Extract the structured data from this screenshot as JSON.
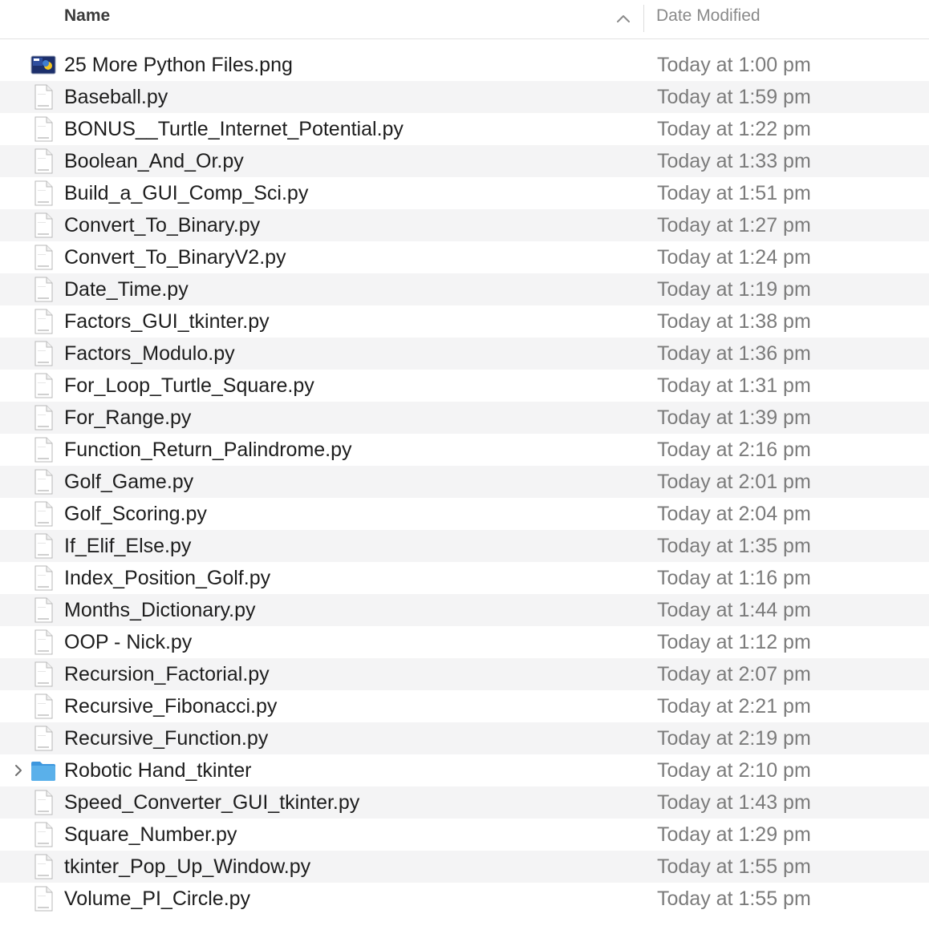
{
  "header": {
    "name_label": "Name",
    "date_label": "Date Modified",
    "sort_icon": "chevron-up-icon"
  },
  "files": [
    {
      "name": "25 More Python Files.png",
      "date": "Today at 1:00 pm",
      "icon": "image-file-icon",
      "expandable": false
    },
    {
      "name": "Baseball.py",
      "date": "Today at 1:59 pm",
      "icon": "python-file-icon",
      "expandable": false
    },
    {
      "name": "BONUS__Turtle_Internet_Potential.py",
      "date": "Today at 1:22 pm",
      "icon": "python-file-icon",
      "expandable": false
    },
    {
      "name": "Boolean_And_Or.py",
      "date": "Today at 1:33 pm",
      "icon": "python-file-icon",
      "expandable": false
    },
    {
      "name": "Build_a_GUI_Comp_Sci.py",
      "date": "Today at 1:51 pm",
      "icon": "python-file-icon",
      "expandable": false
    },
    {
      "name": "Convert_To_Binary.py",
      "date": "Today at 1:27 pm",
      "icon": "python-file-icon",
      "expandable": false
    },
    {
      "name": "Convert_To_BinaryV2.py",
      "date": "Today at 1:24 pm",
      "icon": "python-file-icon",
      "expandable": false
    },
    {
      "name": "Date_Time.py",
      "date": "Today at 1:19 pm",
      "icon": "python-file-icon",
      "expandable": false
    },
    {
      "name": "Factors_GUI_tkinter.py",
      "date": "Today at 1:38 pm",
      "icon": "python-file-icon",
      "expandable": false
    },
    {
      "name": "Factors_Modulo.py",
      "date": "Today at 1:36 pm",
      "icon": "python-file-icon",
      "expandable": false
    },
    {
      "name": "For_Loop_Turtle_Square.py",
      "date": "Today at 1:31 pm",
      "icon": "python-file-icon",
      "expandable": false
    },
    {
      "name": "For_Range.py",
      "date": "Today at 1:39 pm",
      "icon": "python-file-icon",
      "expandable": false
    },
    {
      "name": "Function_Return_Palindrome.py",
      "date": "Today at 2:16 pm",
      "icon": "python-file-icon",
      "expandable": false
    },
    {
      "name": "Golf_Game.py",
      "date": "Today at 2:01 pm",
      "icon": "python-file-icon",
      "expandable": false
    },
    {
      "name": "Golf_Scoring.py",
      "date": "Today at 2:04 pm",
      "icon": "python-file-icon",
      "expandable": false
    },
    {
      "name": "If_Elif_Else.py",
      "date": "Today at 1:35 pm",
      "icon": "python-file-icon",
      "expandable": false
    },
    {
      "name": "Index_Position_Golf.py",
      "date": "Today at 1:16 pm",
      "icon": "python-file-icon",
      "expandable": false
    },
    {
      "name": "Months_Dictionary.py",
      "date": "Today at 1:44 pm",
      "icon": "python-file-icon",
      "expandable": false
    },
    {
      "name": "OOP - Nick.py",
      "date": "Today at 1:12 pm",
      "icon": "python-file-icon",
      "expandable": false
    },
    {
      "name": "Recursion_Factorial.py",
      "date": "Today at 2:07 pm",
      "icon": "python-file-icon",
      "expandable": false
    },
    {
      "name": "Recursive_Fibonacci.py",
      "date": "Today at 2:21 pm",
      "icon": "python-file-icon",
      "expandable": false
    },
    {
      "name": "Recursive_Function.py",
      "date": "Today at 2:19 pm",
      "icon": "python-file-icon",
      "expandable": false
    },
    {
      "name": "Robotic Hand_tkinter",
      "date": "Today at 2:10 pm",
      "icon": "folder-icon",
      "expandable": true
    },
    {
      "name": "Speed_Converter_GUI_tkinter.py",
      "date": "Today at 1:43 pm",
      "icon": "python-file-icon",
      "expandable": false
    },
    {
      "name": "Square_Number.py",
      "date": "Today at 1:29 pm",
      "icon": "python-file-icon",
      "expandable": false
    },
    {
      "name": "tkinter_Pop_Up_Window.py",
      "date": "Today at 1:55 pm",
      "icon": "python-file-icon",
      "expandable": false
    },
    {
      "name": "Volume_PI_Circle.py",
      "date": "Today at 1:55 pm",
      "icon": "python-file-icon",
      "expandable": false
    }
  ],
  "colors": {
    "folder": "#5ab0ea",
    "stripe": "#f4f4f5",
    "date_text": "#7b7b7b"
  }
}
